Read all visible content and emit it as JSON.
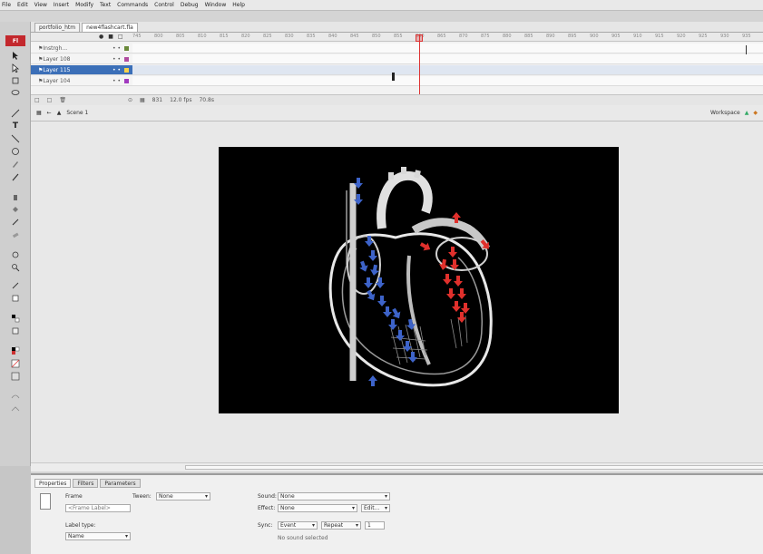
{
  "menu": [
    "File",
    "Edit",
    "View",
    "Insert",
    "Modify",
    "Text",
    "Commands",
    "Control",
    "Debug",
    "Window",
    "Help"
  ],
  "doc_tabs": [
    "portfolio_htm",
    "new4flashcart.fla"
  ],
  "layers": [
    {
      "name": "Instrgh...",
      "color": "#6a8a3a",
      "selected": false
    },
    {
      "name": "Layer 108",
      "color": "#b04ba0",
      "selected": false
    },
    {
      "name": "Layer 115",
      "color": "#f6d24a",
      "selected": true
    },
    {
      "name": "Layer 104",
      "color": "#a13abf",
      "selected": false
    }
  ],
  "ruler_ticks": [
    "745",
    "800",
    "805",
    "810",
    "815",
    "820",
    "825",
    "830",
    "835",
    "840",
    "845",
    "850",
    "855",
    "860",
    "865",
    "870",
    "875",
    "880",
    "885",
    "890",
    "895",
    "900",
    "905",
    "910",
    "915",
    "920",
    "925",
    "930",
    "935"
  ],
  "timeline_foot": {
    "frame": "831",
    "fps": "12.0 fps",
    "time": "70.8s"
  },
  "editbar": {
    "scene": "Scene 1",
    "workspace": "Workspace"
  },
  "props": {
    "tabs": [
      "Properties",
      "Filters",
      "Parameters"
    ],
    "frame_label": "Frame",
    "frame_name_placeholder": "<Frame Label>",
    "tween_label": "Tween:",
    "tween_value": "None",
    "label_type_label": "Label type:",
    "label_type_value": "Name",
    "sound_label": "Sound:",
    "sound_value": "None",
    "effect_label": "Effect:",
    "effect_value": "None",
    "edit_button": "Edit...",
    "sync_label": "Sync:",
    "sync_value": "Event",
    "repeat_value": "Repeat",
    "repeat_count": "1",
    "no_sound": "No sound selected"
  },
  "colors": {
    "stage": "#000000",
    "playhead": "#dd3333",
    "blue_arrow": "#3d63c9",
    "red_arrow": "#e0302c"
  }
}
